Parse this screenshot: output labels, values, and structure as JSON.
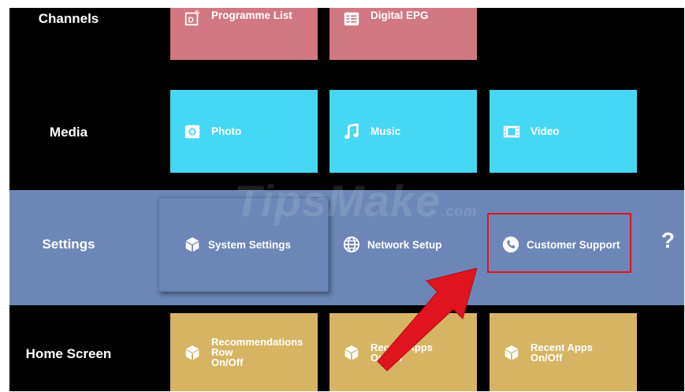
{
  "rows": {
    "channels": {
      "label": "Channels",
      "tiles": [
        {
          "label": "Programme List",
          "icon": "programme-list-icon"
        },
        {
          "label": "Digital EPG",
          "icon": "epg-icon"
        }
      ]
    },
    "media": {
      "label": "Media",
      "tiles": [
        {
          "label": "Photo",
          "icon": "camera-icon"
        },
        {
          "label": "Music",
          "icon": "music-note-icon"
        },
        {
          "label": "Video",
          "icon": "film-icon"
        }
      ]
    },
    "settings": {
      "label": "Settings",
      "items": [
        {
          "label": "System Settings",
          "icon": "cube-icon"
        },
        {
          "label": "Network Setup",
          "icon": "globe-icon"
        },
        {
          "label": "Customer Support",
          "icon": "phone-icon"
        }
      ],
      "help": "?"
    },
    "home_screen": {
      "label": "Home Screen",
      "tiles": [
        {
          "label_lines": [
            "Recommendations",
            "Row",
            "On/Off"
          ],
          "icon": "cube-icon"
        },
        {
          "label_lines": [
            "Recent Apps",
            "On/Off"
          ],
          "icon": "cube-icon"
        },
        {
          "label_lines": [
            "Recent Apps",
            "On/Off"
          ],
          "icon": "cube-icon"
        }
      ]
    }
  },
  "watermark": {
    "text": "TipsMake",
    "suffix": ".com"
  },
  "colors": {
    "pink_tile": "#d27882",
    "cyan_tile": "#46d7f5",
    "gold_tile": "#d7b464",
    "settings_band": "#6c87b7",
    "highlight": "#e0141e"
  }
}
